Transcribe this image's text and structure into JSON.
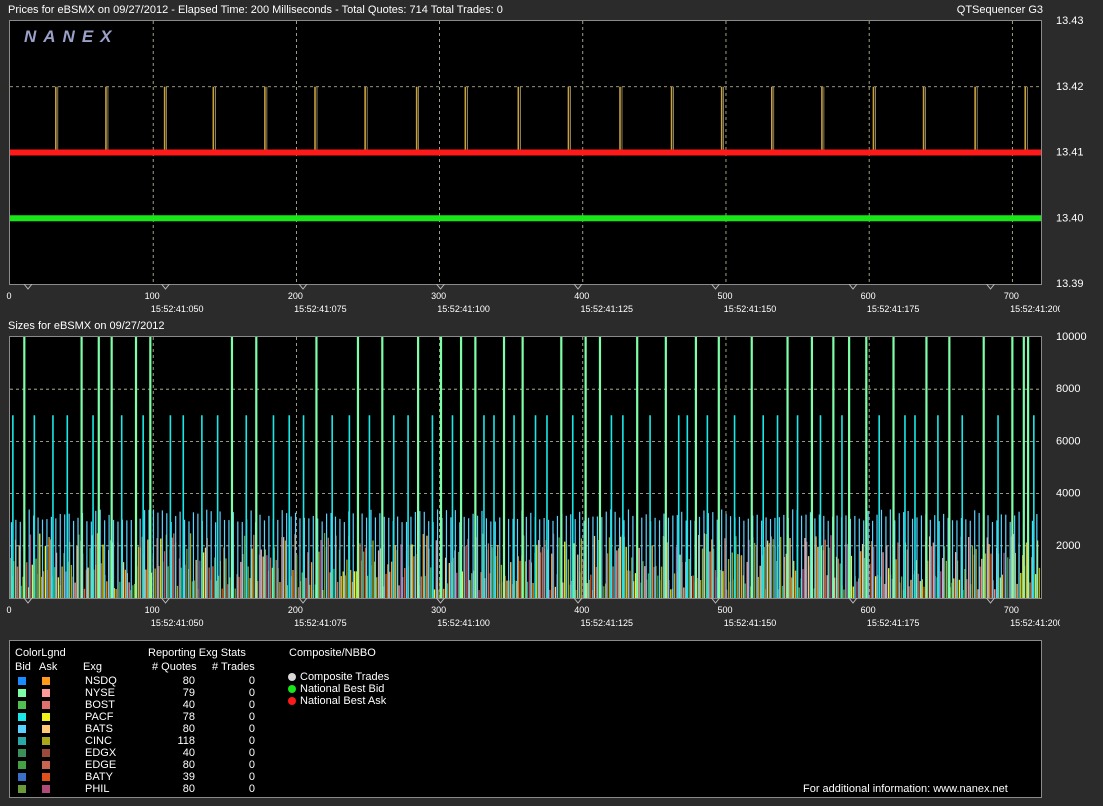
{
  "header": {
    "title": "Prices for  eBSMX  on  09/27/2012  -  Elapsed Time: 200 Milliseconds  -  Total Quotes: 714  Total Trades: 0",
    "app": "QTSequencer G3"
  },
  "sizes_header": "Sizes for  eBSMX  on  09/27/2012",
  "logo": "NANEX",
  "colors": {
    "bid_line": "#17e617",
    "ask_line": "#ff1a1a",
    "price_ticks": "#c8a23a",
    "grid": "#c8c8a0",
    "composite_trades": "#d8d8d8"
  },
  "chart_data": [
    {
      "type": "line",
      "title": "Prices for  eBSMX  on  09/27/2012",
      "x_ticks": [
        0,
        100,
        200,
        300,
        400,
        500,
        600,
        700
      ],
      "time_labels": [
        "15:52:41:050",
        "15:52:41:075",
        "15:52:41:100",
        "15:52:41:125",
        "15:52:41:150",
        "15:52:41:175",
        "15:52:41:200"
      ],
      "y_ticks": [
        "13.43",
        "13.42",
        "13.41",
        "13.40",
        "13.39"
      ],
      "xlim": [
        0,
        720
      ],
      "ylim": [
        13.39,
        13.43
      ],
      "series": [
        {
          "name": "National Best Ask",
          "x": [
            0,
            720
          ],
          "values": [
            13.41,
            13.41
          ]
        },
        {
          "name": "National Best Bid",
          "x": [
            0,
            720
          ],
          "values": [
            13.4,
            13.4
          ]
        }
      ],
      "ask_spikes_to": 13.42,
      "ask_spike_x": [
        32,
        67,
        108,
        142,
        178,
        213,
        248,
        284,
        318,
        355,
        390,
        426,
        462,
        497,
        532,
        567,
        603,
        638,
        674,
        709
      ]
    },
    {
      "type": "bar",
      "title": "Sizes for  eBSMX  on  09/27/2012",
      "x_ticks": [
        0,
        100,
        200,
        300,
        400,
        500,
        600,
        700
      ],
      "time_labels": [
        "15:52:41:050",
        "15:52:41:075",
        "15:52:41:100",
        "15:52:41:125",
        "15:52:41:150",
        "15:52:41:175",
        "15:52:41:200"
      ],
      "y_ticks": [
        "10000",
        "8000",
        "6000",
        "4000",
        "2000"
      ],
      "xlim": [
        0,
        720
      ],
      "ylim": [
        0,
        10000
      ],
      "max_size_x": [
        10,
        50,
        62,
        71,
        88,
        98,
        155,
        172,
        214,
        243,
        260,
        285,
        301,
        315,
        325,
        345,
        358,
        385,
        402,
        412,
        438,
        458,
        479,
        495,
        518,
        543,
        560,
        575,
        586,
        598,
        617,
        640,
        656,
        680,
        700,
        708,
        711
      ],
      "mid_size_x": [
        2,
        17,
        30,
        40,
        58,
        78,
        93,
        112,
        121,
        134,
        145,
        165,
        184,
        195,
        205,
        225,
        237,
        251,
        268,
        278,
        295,
        309,
        331,
        338,
        352,
        367,
        375,
        393,
        420,
        428,
        447,
        467,
        473,
        487,
        506,
        526,
        536,
        550,
        566,
        581,
        607,
        625,
        632,
        648,
        665,
        690,
        715
      ]
    }
  ],
  "legend": {
    "title": "ColorLgnd",
    "bid_label": "Bid",
    "ask_label": "Ask",
    "exg_label": "Exg",
    "stats_title": "Reporting Exg Stats",
    "quotes_label": "# Quotes",
    "trades_label": "# Trades",
    "composite_title": "Composite/NBBO",
    "rows": [
      {
        "exg": "NSDQ",
        "quotes": "80",
        "trades": "0",
        "bid_color": "#1a8cff",
        "ask_color": "#ff9a1a"
      },
      {
        "exg": "NYSE",
        "quotes": "79",
        "trades": "0",
        "bid_color": "#7dffa8",
        "ask_color": "#ff9a9a"
      },
      {
        "exg": "BOST",
        "quotes": "40",
        "trades": "0",
        "bid_color": "#4fbf4f",
        "ask_color": "#e07070"
      },
      {
        "exg": "PACF",
        "quotes": "78",
        "trades": "0",
        "bid_color": "#19e8e8",
        "ask_color": "#f0f01a"
      },
      {
        "exg": "BATS",
        "quotes": "80",
        "trades": "0",
        "bid_color": "#5ad2ff",
        "ask_color": "#ffc878"
      },
      {
        "exg": "CINC",
        "quotes": "118",
        "trades": "0",
        "bid_color": "#2aa8a8",
        "ask_color": "#a8a81a"
      },
      {
        "exg": "EDGX",
        "quotes": "40",
        "trades": "0",
        "bid_color": "#3a8f5a",
        "ask_color": "#9a4a3a"
      },
      {
        "exg": "EDGE",
        "quotes": "80",
        "trades": "0",
        "bid_color": "#45a045",
        "ask_color": "#c86450"
      },
      {
        "exg": "BATY",
        "quotes": "39",
        "trades": "0",
        "bid_color": "#3a70c8",
        "ask_color": "#e0501a"
      },
      {
        "exg": "PHIL",
        "quotes": "80",
        "trades": "0",
        "bid_color": "#6a9a3a",
        "ask_color": "#b04a78"
      }
    ],
    "composite_items": [
      {
        "label": "Composite Trades",
        "color": "#d8d8d8"
      },
      {
        "label": "National Best Bid",
        "color": "#17e617"
      },
      {
        "label": "National Best Ask",
        "color": "#ff1a1a"
      }
    ],
    "footer": "For additional information: www.nanex.net"
  }
}
